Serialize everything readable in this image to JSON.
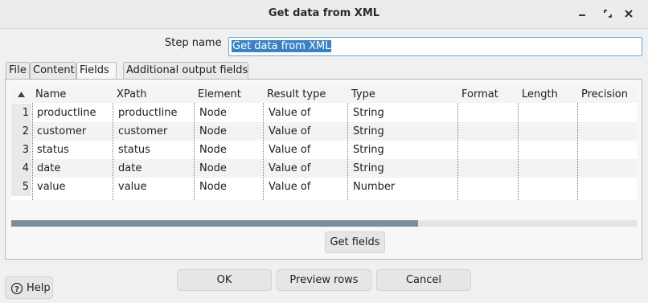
{
  "window": {
    "title": "Get data from XML"
  },
  "step": {
    "label": "Step name",
    "value": "Get data from XML"
  },
  "tabs": [
    {
      "label": "File"
    },
    {
      "label": "Content"
    },
    {
      "label": "Fields",
      "active": true
    },
    {
      "label": "Additional output fields"
    }
  ],
  "table": {
    "columns": [
      "Name",
      "XPath",
      "Element",
      "Result type",
      "Type",
      "Format",
      "Length",
      "Precision"
    ],
    "rows": [
      {
        "num": "1",
        "name": "productline",
        "xpath": "productline",
        "element": "Node",
        "result_type": "Value of",
        "type": "String"
      },
      {
        "num": "2",
        "name": "customer",
        "xpath": "customer",
        "element": "Node",
        "result_type": "Value of",
        "type": "String"
      },
      {
        "num": "3",
        "name": "status",
        "xpath": "status",
        "element": "Node",
        "result_type": "Value of",
        "type": "String"
      },
      {
        "num": "4",
        "name": "date",
        "xpath": "date",
        "element": "Node",
        "result_type": "Value of",
        "type": "String"
      },
      {
        "num": "5",
        "name": "value",
        "xpath": "value",
        "element": "Node",
        "result_type": "Value of",
        "type": "Number"
      }
    ]
  },
  "buttons": {
    "get_fields": "Get fields",
    "ok": "OK",
    "preview": "Preview rows",
    "cancel": "Cancel",
    "help": "Help"
  },
  "icons": {
    "minimize": "minimize-icon",
    "maximize": "maximize-icon",
    "close": "close-icon",
    "help": "help-icon",
    "sort": "sort-arrow-icon"
  }
}
